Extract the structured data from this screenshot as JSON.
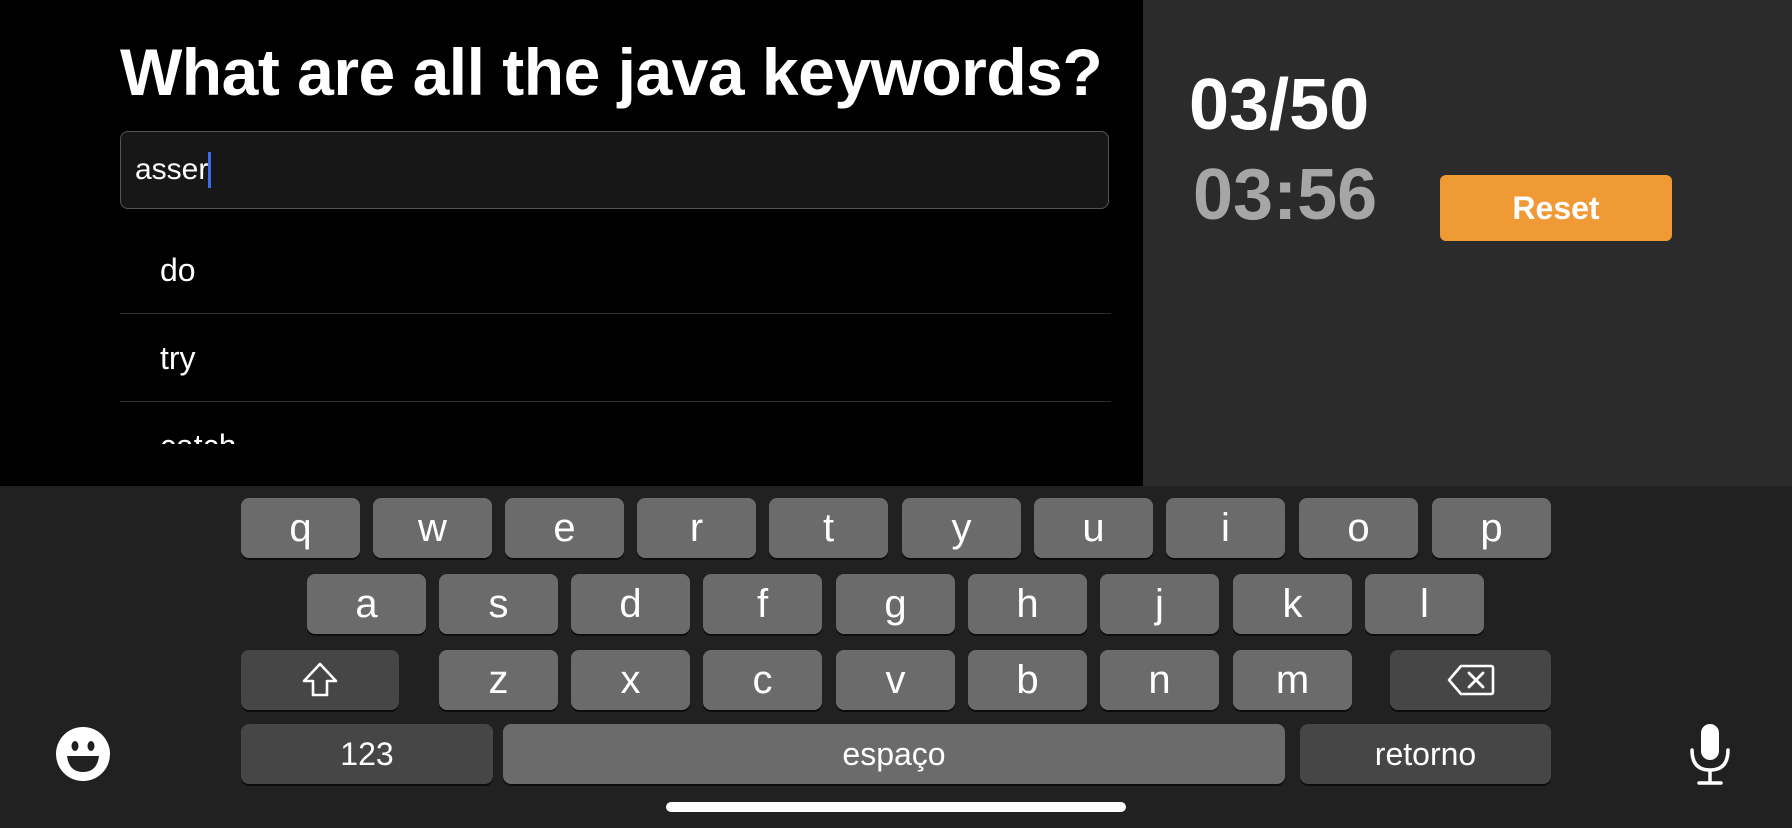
{
  "quiz": {
    "title": "What are all the java keywords?",
    "input_value": "asser",
    "answers": [
      "do",
      "try",
      "catch"
    ]
  },
  "sidebar": {
    "counter": "03/50",
    "timer": "03:56",
    "reset_label": "Reset",
    "accent_color": "#f09a36"
  },
  "keyboard": {
    "row1": [
      "q",
      "w",
      "e",
      "r",
      "t",
      "y",
      "u",
      "i",
      "o",
      "p"
    ],
    "row2": [
      "a",
      "s",
      "d",
      "f",
      "g",
      "h",
      "j",
      "k",
      "l"
    ],
    "row3": [
      "z",
      "x",
      "c",
      "v",
      "b",
      "n",
      "m"
    ],
    "numbers_label": "123",
    "space_label": "espaço",
    "return_label": "retorno",
    "icons": [
      "shift-icon",
      "backspace-icon",
      "emoji-icon",
      "microphone-icon"
    ]
  }
}
